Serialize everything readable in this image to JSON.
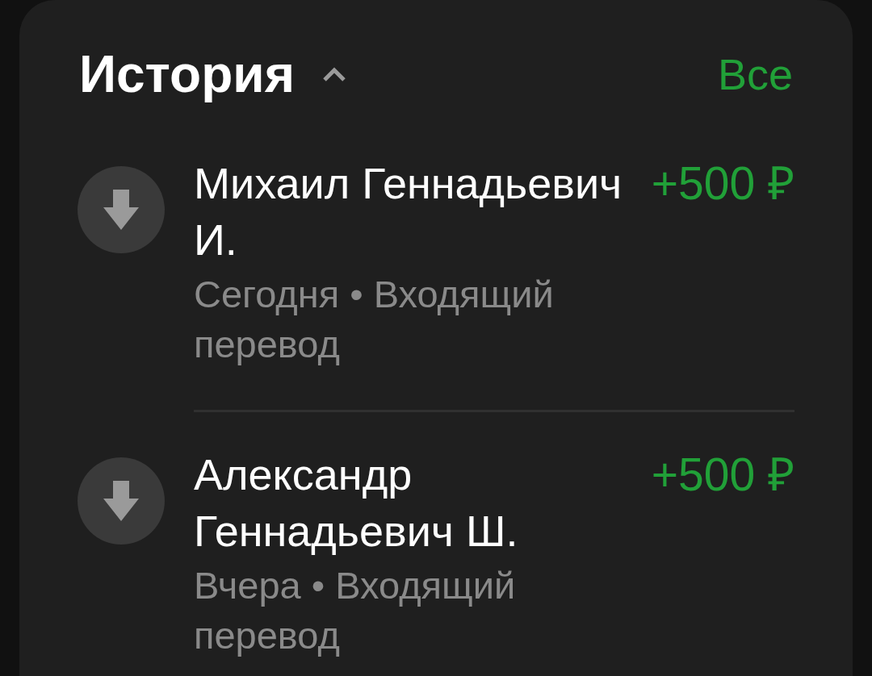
{
  "header": {
    "title": "История",
    "expanded": true,
    "link": "Все"
  },
  "transactions": [
    {
      "name": "Михаил Геннадьевич И.",
      "amount": "+500 ₽",
      "details": "Сегодня • Входящий перевод"
    },
    {
      "name": "Александр Геннадьевич Ш.",
      "amount": "+500 ₽",
      "details": "Вчера • Входящий перевод"
    }
  ]
}
